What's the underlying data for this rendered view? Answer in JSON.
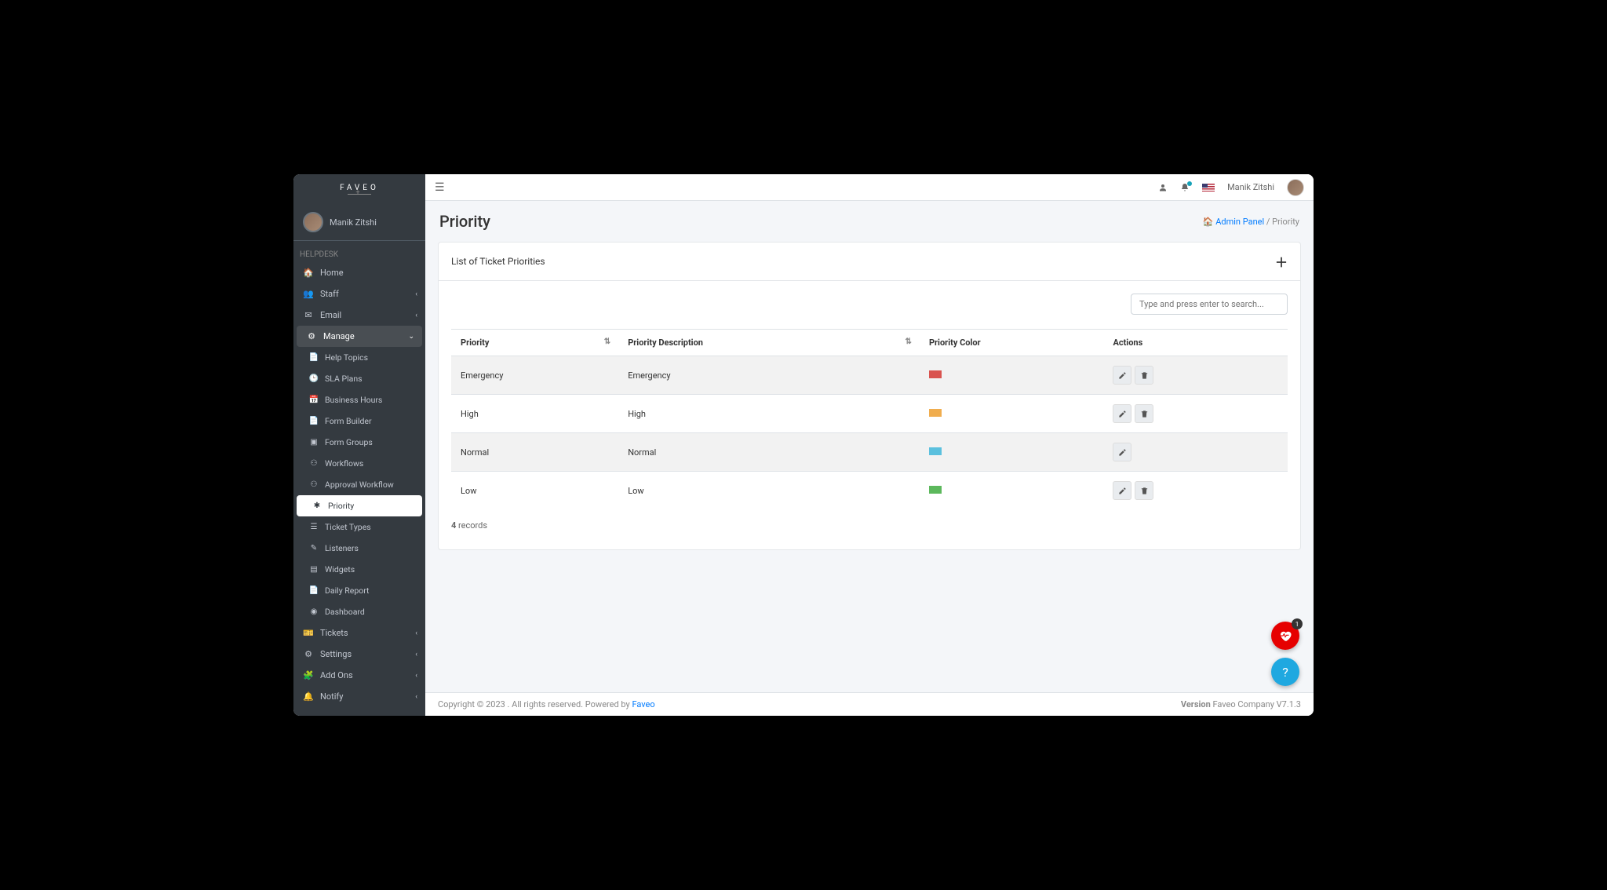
{
  "logo": "FAVEO",
  "user": {
    "name": "Manik Zitshi"
  },
  "sidebar": {
    "section": "HELPDESK",
    "items": {
      "home": "Home",
      "staff": "Staff",
      "email": "Email",
      "manage": "Manage",
      "tickets": "Tickets",
      "settings": "Settings",
      "addons": "Add Ons",
      "notify": "Notify"
    },
    "manage_sub": {
      "help_topics": "Help Topics",
      "sla_plans": "SLA Plans",
      "business_hours": "Business Hours",
      "form_builder": "Form Builder",
      "form_groups": "Form Groups",
      "workflows": "Workflows",
      "approval_workflow": "Approval Workflow",
      "priority": "Priority",
      "ticket_types": "Ticket Types",
      "listeners": "Listeners",
      "widgets": "Widgets",
      "daily_report": "Daily Report",
      "dashboard": "Dashboard"
    }
  },
  "topbar": {
    "user_name": "Manik Zitshi"
  },
  "page": {
    "title": "Priority",
    "breadcrumb_home": "Admin Panel",
    "breadcrumb_current": "Priority"
  },
  "card": {
    "title": "List of Ticket Priorities",
    "search_placeholder": "Type and press enter to search...",
    "columns": {
      "priority": "Priority",
      "description": "Priority Description",
      "color": "Priority Color",
      "actions": "Actions"
    },
    "rows": [
      {
        "priority": "Emergency",
        "description": "Emergency",
        "color": "#d9534f",
        "deletable": true
      },
      {
        "priority": "High",
        "description": "High",
        "color": "#f0ad4e",
        "deletable": true
      },
      {
        "priority": "Normal",
        "description": "Normal",
        "color": "#5bc0de",
        "deletable": false
      },
      {
        "priority": "Low",
        "description": "Low",
        "color": "#5cb85c",
        "deletable": true
      }
    ],
    "records_count": "4",
    "records_label": " records"
  },
  "footer": {
    "copyright": "Copyright © 2023 .  All rights reserved. Powered by ",
    "powered_link": "Faveo",
    "version_label": "Version",
    "version_text": " Faveo Company V7.1.3"
  },
  "fab": {
    "heart_badge": "1"
  }
}
